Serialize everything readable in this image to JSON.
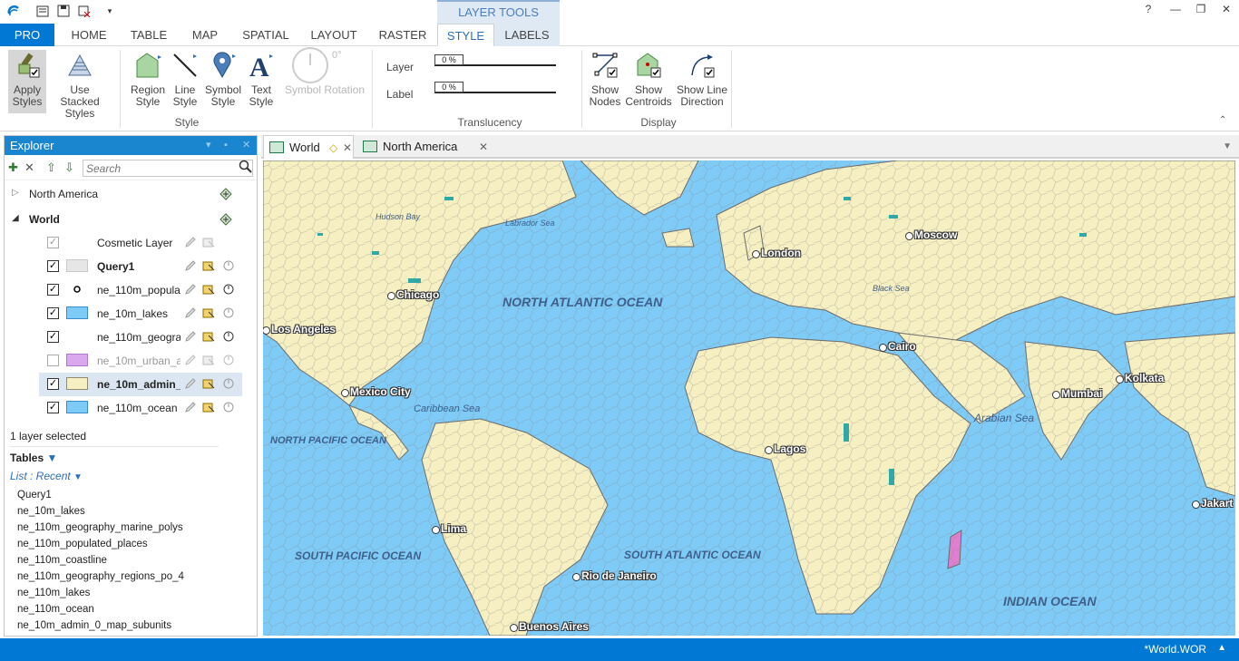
{
  "titlebar": {
    "help": "?"
  },
  "context_group": "LAYER TOOLS",
  "tabs": [
    "PRO",
    "HOME",
    "TABLE",
    "MAP",
    "SPATIAL",
    "LAYOUT",
    "RASTER",
    "STYLE",
    "LABELS"
  ],
  "ribbon": {
    "apply_styles": "Apply Styles",
    "use_stacked": "Use Stacked Styles",
    "region_style": "Region Style",
    "line_style": "Line Style",
    "symbol_style": "Symbol Style",
    "text_style": "Text Style",
    "symbol_rotation": "Symbol Rotation",
    "rotation_value": "0°",
    "style_group": "Style",
    "layer": "Layer",
    "label": "Label",
    "layer_pct": "0 %",
    "label_pct": "0 %",
    "translucency_group": "Translucency",
    "show_nodes": "Show Nodes",
    "show_centroids": "Show Centroids",
    "show_line_direction": "Show Line Direction",
    "display_group": "Display"
  },
  "explorer": {
    "title": "Explorer",
    "search_placeholder": "Search",
    "maps": [
      "North America",
      "World"
    ],
    "layers": [
      {
        "name": "Cosmetic Layer",
        "checked": true
      },
      {
        "name": "Query1",
        "checked": true
      },
      {
        "name": "ne_110m_popula",
        "checked": true
      },
      {
        "name": "ne_10m_lakes",
        "checked": true
      },
      {
        "name": "ne_110m_geogra",
        "checked": true
      },
      {
        "name": "ne_10m_urban_a",
        "checked": false
      },
      {
        "name": "ne_10m_admin_",
        "checked": true
      },
      {
        "name": "ne_110m_ocean",
        "checked": true
      }
    ],
    "status": "1 layer selected",
    "tables_label": "Tables",
    "list_recent": "List : Recent",
    "tables": [
      "Query1",
      "ne_10m_lakes",
      "ne_110m_geography_marine_polys",
      "ne_110m_populated_places",
      "ne_110m_coastline",
      "ne_110m_geography_regions_po_4",
      "ne_110m_lakes",
      "ne_110m_ocean",
      "ne_10m_admin_0_map_subunits"
    ]
  },
  "doc_tabs": [
    "World",
    "North America"
  ],
  "map": {
    "cities": [
      "London",
      "Moscow",
      "Chicago",
      "Los Angeles",
      "Cairo",
      "Mexico City",
      "Mumbai",
      "Kolkata",
      "Lagos",
      "Lima",
      "Rio de Janeiro",
      "Buenos Aires",
      "Jakart"
    ],
    "oceans": [
      "NORTH ATLANTIC OCEAN",
      "NORTH PACIFIC OCEAN",
      "SOUTH PACIFIC OCEAN",
      "SOUTH ATLANTIC OCEAN",
      "INDIAN OCEAN"
    ],
    "seas": [
      "Hudson Bay",
      "Labrador Sea",
      "Black Sea",
      "Caribbean Sea",
      "Arabian Sea"
    ],
    "colors": {
      "water": "#7ecbf7",
      "land": "#f6efc2",
      "border": "#6b6b6b"
    }
  },
  "statusbar": {
    "workspace": "*World.WOR"
  }
}
